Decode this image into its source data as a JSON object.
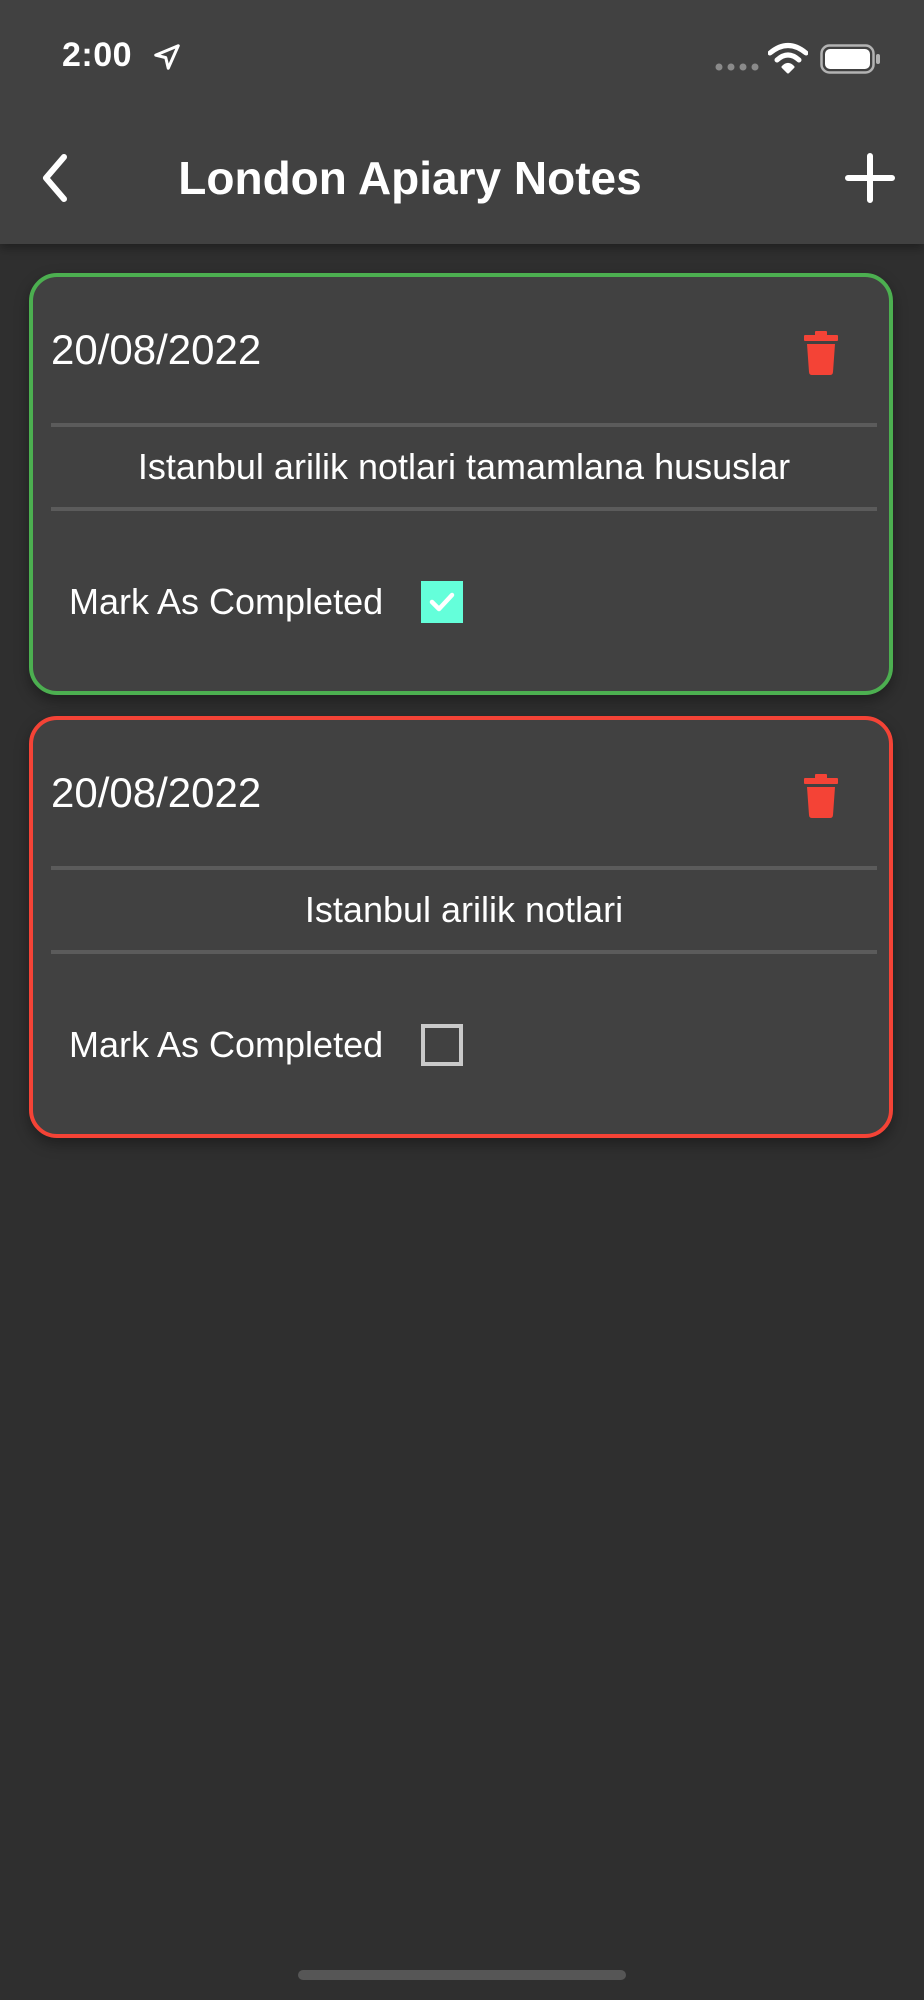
{
  "status_bar": {
    "time": "2:00",
    "icons": [
      "location-arrow-icon",
      "signal-dots-icon",
      "wifi-icon",
      "battery-icon"
    ]
  },
  "nav": {
    "title": "London Apiary Notes",
    "back_icon": "chevron-left-icon",
    "add_icon": "plus-icon"
  },
  "notes": [
    {
      "date": "20/08/2022",
      "text": "Istanbul arilik notlari tamamlana hususlar",
      "completed_label": "Mark As Completed",
      "completed": true,
      "border_color": "#4caf50"
    },
    {
      "date": "20/08/2022",
      "text": "Istanbul arilik notlari",
      "completed_label": "Mark As Completed",
      "completed": false,
      "border_color": "#f44336"
    }
  ],
  "colors": {
    "background": "#2f2f2f",
    "card": "#414141",
    "delete": "#f44336",
    "checkbox_checked": "#64ffda",
    "completed_border": "#4caf50",
    "pending_border": "#f44336"
  }
}
